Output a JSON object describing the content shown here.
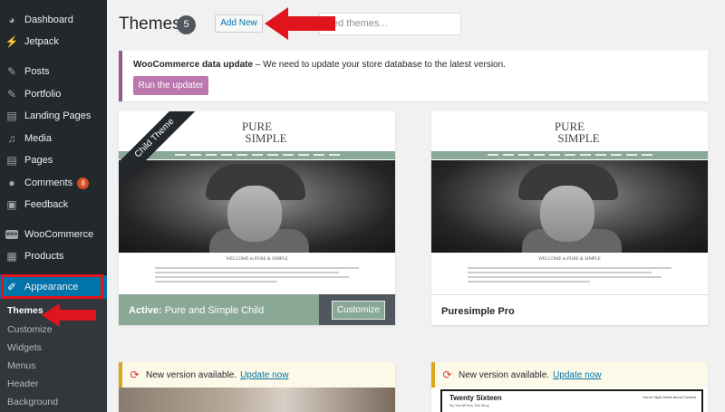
{
  "sidebar": {
    "items": [
      {
        "label": "Dashboard",
        "icon": "dashboard-icon"
      },
      {
        "label": "Jetpack",
        "icon": "jetpack-icon"
      },
      {
        "label": "Posts",
        "icon": "pin-icon"
      },
      {
        "label": "Portfolio",
        "icon": "pin-icon"
      },
      {
        "label": "Landing Pages",
        "icon": "pages-icon"
      },
      {
        "label": "Media",
        "icon": "media-icon"
      },
      {
        "label": "Pages",
        "icon": "pages-icon"
      },
      {
        "label": "Comments",
        "icon": "comments-icon",
        "badge": "8"
      },
      {
        "label": "Feedback",
        "icon": "feedback-icon"
      },
      {
        "label": "WooCommerce",
        "icon": "woocommerce-icon",
        "icon_text": "woo"
      },
      {
        "label": "Products",
        "icon": "products-icon"
      },
      {
        "label": "Appearance",
        "icon": "paintbrush-icon"
      }
    ],
    "submenu": [
      "Themes",
      "Customize",
      "Widgets",
      "Menus",
      "Header",
      "Background"
    ]
  },
  "header": {
    "title": "Themes",
    "count": "5",
    "add_new": "Add New",
    "search_placeholder": "ed themes..."
  },
  "notice": {
    "bold": "WooCommerce data update",
    "text": " – We need to update your store database to the latest version.",
    "button": "Run the updater"
  },
  "themes": [
    {
      "ribbon": "Child Theme",
      "logo_line1": "PURE",
      "logo_line2": "SIMPLE",
      "welcome": "WELCOME to PURE & SIMPLE",
      "active_prefix": "Active:",
      "name": "Pure and Simple Child",
      "customize": "Customize"
    },
    {
      "logo_line1": "PURE",
      "logo_line2": "SIMPLE",
      "welcome": "WELCOME to PURE & SIMPLE",
      "name": "Puresimple Pro"
    }
  ],
  "updates": [
    {
      "text": "New version available.",
      "link": "Update now"
    },
    {
      "text": "New version available.",
      "link": "Update now",
      "preview_title": "Twenty Sixteen",
      "preview_tagline": "My WordPress Test Blog",
      "preview_nav": "Home   Style Guide   About   Contact"
    }
  ],
  "colors": {
    "sidebar_bg": "#23282d",
    "accent": "#0073aa",
    "annotation_red": "#e0141c",
    "woo_purple": "#96588a",
    "theme_green": "#8aa896"
  }
}
